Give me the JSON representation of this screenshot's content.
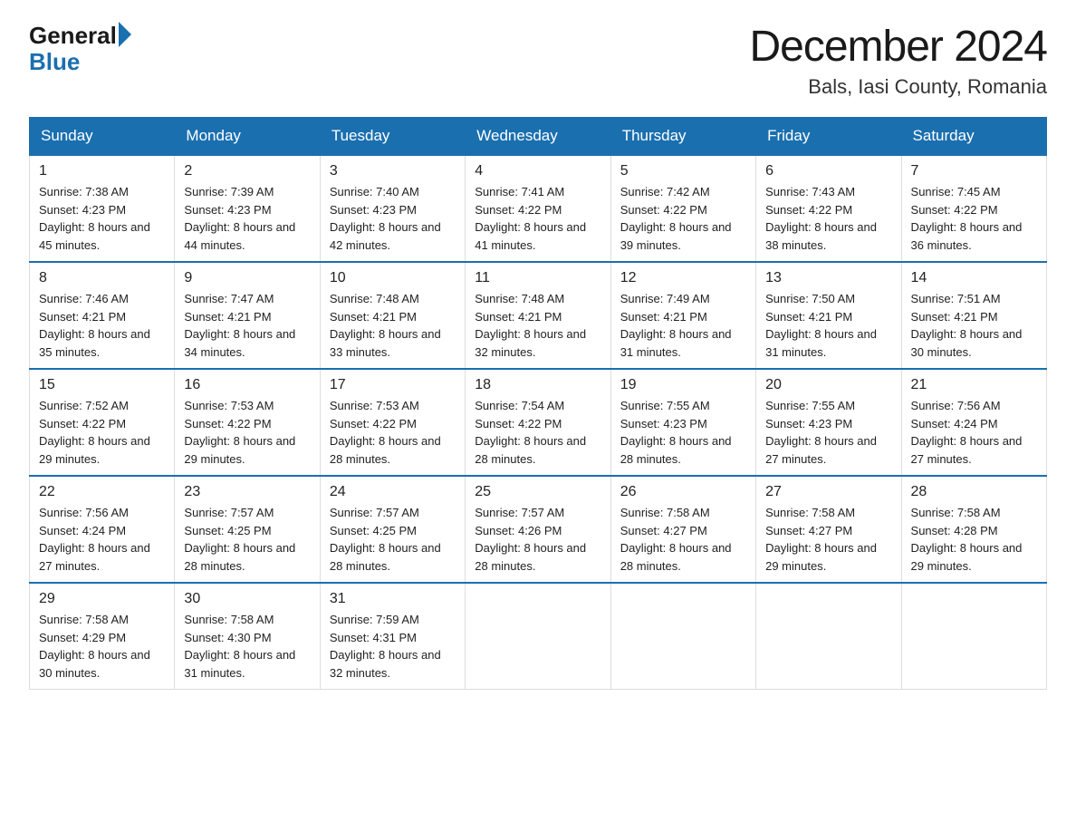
{
  "logo": {
    "general": "General",
    "blue": "Blue"
  },
  "title": {
    "month": "December 2024",
    "location": "Bals, Iasi County, Romania"
  },
  "weekdays": [
    "Sunday",
    "Monday",
    "Tuesday",
    "Wednesday",
    "Thursday",
    "Friday",
    "Saturday"
  ],
  "weeks": [
    [
      {
        "day": "1",
        "sunrise": "7:38 AM",
        "sunset": "4:23 PM",
        "daylight": "8 hours and 45 minutes."
      },
      {
        "day": "2",
        "sunrise": "7:39 AM",
        "sunset": "4:23 PM",
        "daylight": "8 hours and 44 minutes."
      },
      {
        "day": "3",
        "sunrise": "7:40 AM",
        "sunset": "4:23 PM",
        "daylight": "8 hours and 42 minutes."
      },
      {
        "day": "4",
        "sunrise": "7:41 AM",
        "sunset": "4:22 PM",
        "daylight": "8 hours and 41 minutes."
      },
      {
        "day": "5",
        "sunrise": "7:42 AM",
        "sunset": "4:22 PM",
        "daylight": "8 hours and 39 minutes."
      },
      {
        "day": "6",
        "sunrise": "7:43 AM",
        "sunset": "4:22 PM",
        "daylight": "8 hours and 38 minutes."
      },
      {
        "day": "7",
        "sunrise": "7:45 AM",
        "sunset": "4:22 PM",
        "daylight": "8 hours and 36 minutes."
      }
    ],
    [
      {
        "day": "8",
        "sunrise": "7:46 AM",
        "sunset": "4:21 PM",
        "daylight": "8 hours and 35 minutes."
      },
      {
        "day": "9",
        "sunrise": "7:47 AM",
        "sunset": "4:21 PM",
        "daylight": "8 hours and 34 minutes."
      },
      {
        "day": "10",
        "sunrise": "7:48 AM",
        "sunset": "4:21 PM",
        "daylight": "8 hours and 33 minutes."
      },
      {
        "day": "11",
        "sunrise": "7:48 AM",
        "sunset": "4:21 PM",
        "daylight": "8 hours and 32 minutes."
      },
      {
        "day": "12",
        "sunrise": "7:49 AM",
        "sunset": "4:21 PM",
        "daylight": "8 hours and 31 minutes."
      },
      {
        "day": "13",
        "sunrise": "7:50 AM",
        "sunset": "4:21 PM",
        "daylight": "8 hours and 31 minutes."
      },
      {
        "day": "14",
        "sunrise": "7:51 AM",
        "sunset": "4:21 PM",
        "daylight": "8 hours and 30 minutes."
      }
    ],
    [
      {
        "day": "15",
        "sunrise": "7:52 AM",
        "sunset": "4:22 PM",
        "daylight": "8 hours and 29 minutes."
      },
      {
        "day": "16",
        "sunrise": "7:53 AM",
        "sunset": "4:22 PM",
        "daylight": "8 hours and 29 minutes."
      },
      {
        "day": "17",
        "sunrise": "7:53 AM",
        "sunset": "4:22 PM",
        "daylight": "8 hours and 28 minutes."
      },
      {
        "day": "18",
        "sunrise": "7:54 AM",
        "sunset": "4:22 PM",
        "daylight": "8 hours and 28 minutes."
      },
      {
        "day": "19",
        "sunrise": "7:55 AM",
        "sunset": "4:23 PM",
        "daylight": "8 hours and 28 minutes."
      },
      {
        "day": "20",
        "sunrise": "7:55 AM",
        "sunset": "4:23 PM",
        "daylight": "8 hours and 27 minutes."
      },
      {
        "day": "21",
        "sunrise": "7:56 AM",
        "sunset": "4:24 PM",
        "daylight": "8 hours and 27 minutes."
      }
    ],
    [
      {
        "day": "22",
        "sunrise": "7:56 AM",
        "sunset": "4:24 PM",
        "daylight": "8 hours and 27 minutes."
      },
      {
        "day": "23",
        "sunrise": "7:57 AM",
        "sunset": "4:25 PM",
        "daylight": "8 hours and 28 minutes."
      },
      {
        "day": "24",
        "sunrise": "7:57 AM",
        "sunset": "4:25 PM",
        "daylight": "8 hours and 28 minutes."
      },
      {
        "day": "25",
        "sunrise": "7:57 AM",
        "sunset": "4:26 PM",
        "daylight": "8 hours and 28 minutes."
      },
      {
        "day": "26",
        "sunrise": "7:58 AM",
        "sunset": "4:27 PM",
        "daylight": "8 hours and 28 minutes."
      },
      {
        "day": "27",
        "sunrise": "7:58 AM",
        "sunset": "4:27 PM",
        "daylight": "8 hours and 29 minutes."
      },
      {
        "day": "28",
        "sunrise": "7:58 AM",
        "sunset": "4:28 PM",
        "daylight": "8 hours and 29 minutes."
      }
    ],
    [
      {
        "day": "29",
        "sunrise": "7:58 AM",
        "sunset": "4:29 PM",
        "daylight": "8 hours and 30 minutes."
      },
      {
        "day": "30",
        "sunrise": "7:58 AM",
        "sunset": "4:30 PM",
        "daylight": "8 hours and 31 minutes."
      },
      {
        "day": "31",
        "sunrise": "7:59 AM",
        "sunset": "4:31 PM",
        "daylight": "8 hours and 32 minutes."
      },
      null,
      null,
      null,
      null
    ]
  ]
}
